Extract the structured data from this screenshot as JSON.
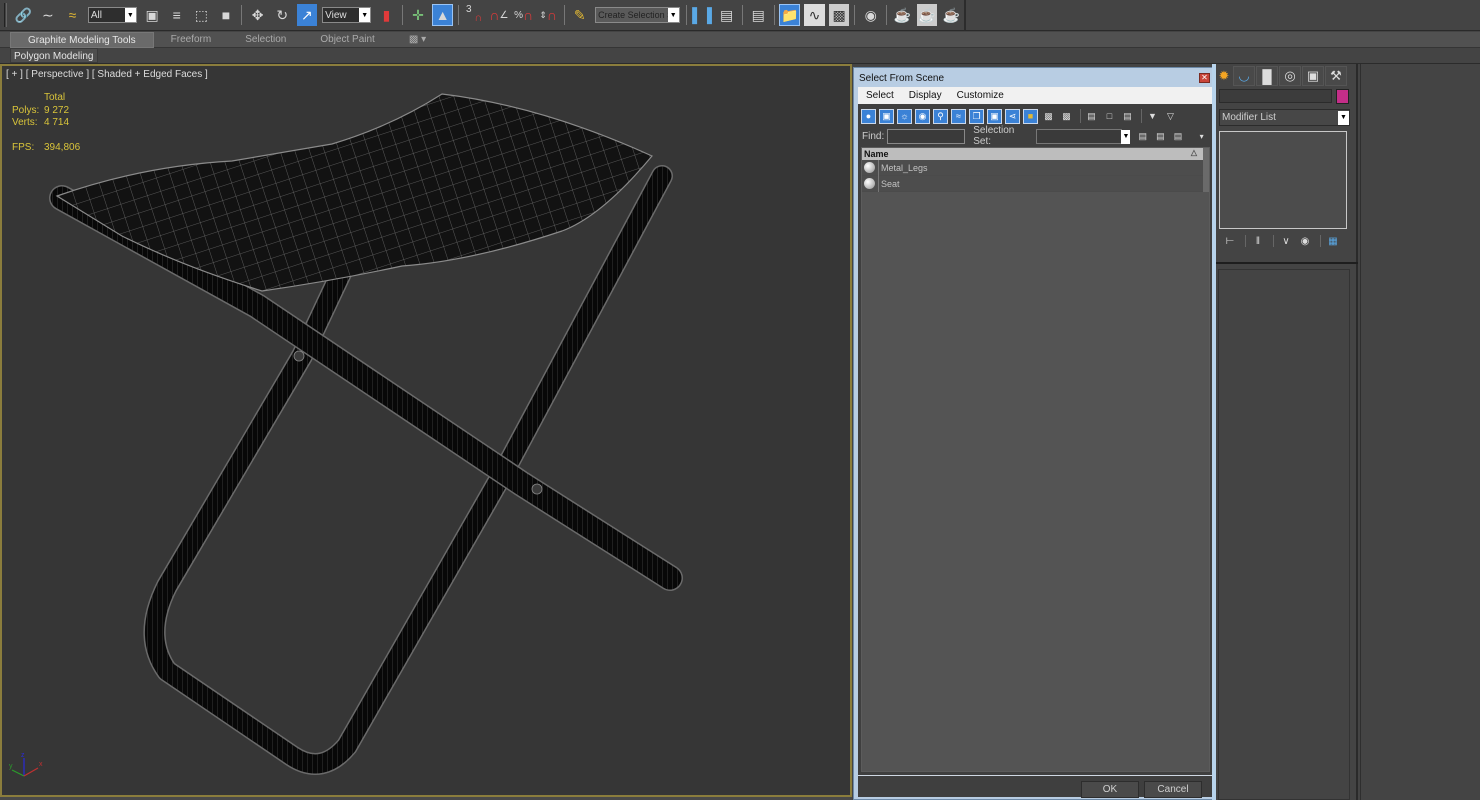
{
  "toolbar": {
    "selection_filter": "All",
    "reference_coord": "View",
    "snap_angle_label": "3",
    "named_selection_placeholder": "Create Selection Se",
    "icons": [
      "link-icon",
      "unlink-icon",
      "bind-space-warp-icon",
      "select-object-icon",
      "select-by-name-icon",
      "rect-selection-region-icon",
      "window-crossing-icon",
      "move-icon",
      "rotate-icon",
      "scale-icon",
      "select-manipulate-icon",
      "use-pivot-center-icon",
      "keyboard-shortcut-override-icon",
      "snaps-toggle-icon",
      "angle-snap-icon",
      "percent-snap-icon",
      "spinner-snap-icon",
      "edit-named-selection-icon",
      "mirror-icon",
      "align-icon",
      "layer-manager-icon",
      "scene-explorer-icon",
      "curve-editor-icon",
      "schematic-view-icon",
      "material-editor-icon",
      "render-setup-icon",
      "rendered-frame-window-icon",
      "render-production-icon"
    ]
  },
  "ribbon": {
    "tabs": [
      "Graphite Modeling Tools",
      "Freeform",
      "Selection",
      "Object Paint"
    ],
    "active_tab": "Graphite Modeling Tools",
    "panel": "Polygon Modeling"
  },
  "viewport": {
    "label": "[ + ] [ Perspective ] [ Shaded + Edged Faces ]",
    "stats": {
      "header": "Total",
      "polys_label": "Polys:",
      "polys": "9 272",
      "verts_label": "Verts:",
      "verts": "4 714",
      "fps_label": "FPS:",
      "fps": "394,806"
    },
    "axis": {
      "x": "x",
      "y": "y",
      "z": "z"
    }
  },
  "dialog": {
    "title": "Select From Scene",
    "menu": [
      "Select",
      "Display",
      "Customize"
    ],
    "find_label": "Find:",
    "find_value": "",
    "selection_set_label": "Selection Set:",
    "selection_set_value": "",
    "column_header": "Name",
    "objects": [
      {
        "name": "Metal_Legs",
        "type": "geometry"
      },
      {
        "name": "Seat",
        "type": "geometry"
      }
    ],
    "ok_label": "OK",
    "cancel_label": "Cancel"
  },
  "command_panel": {
    "tabs": [
      "create-tab",
      "modify-tab",
      "hierarchy-tab",
      "motion-tab",
      "display-tab",
      "utilities-tab"
    ],
    "active_tab": "modify-tab",
    "object_name": "",
    "object_color": "#c42e88",
    "modifier_list": "Modifier List"
  }
}
